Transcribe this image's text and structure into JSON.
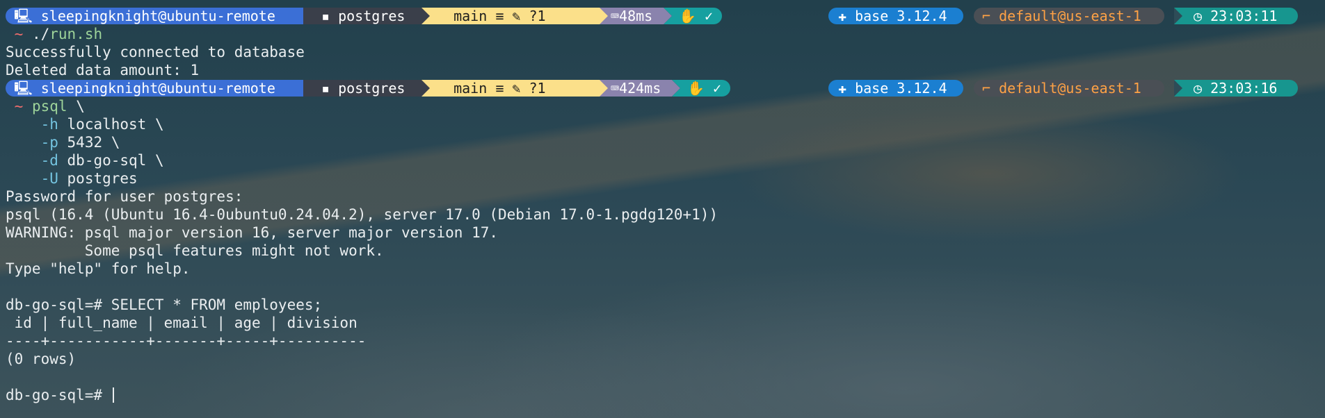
{
  "prompts": [
    {
      "os_icon": "🖳",
      "user_host": "sleepingknight@ubuntu-remote",
      "folder_icon": "▪",
      "path": "postgres",
      "github_icon": "",
      "branch_icon": "",
      "branch": "main",
      "git_status": "≡ ✎ ?1",
      "exec_icon": "⌨",
      "exec_time": "48ms",
      "status_icon": "✋",
      "status_check": "✓",
      "python_icon": "✚",
      "python": "base 3.12.4",
      "aws_icon": "⌐",
      "aws": "default@us-east-1",
      "clock_icon": "◷",
      "time": "23:03:11"
    },
    {
      "os_icon": "🖳",
      "user_host": "sleepingknight@ubuntu-remote",
      "folder_icon": "▪",
      "path": "postgres",
      "github_icon": "",
      "branch_icon": "",
      "branch": "main",
      "git_status": "≡ ✎ ?1",
      "exec_icon": "⌨",
      "exec_time": "424ms",
      "status_icon": "✋",
      "status_check": "✓",
      "python_icon": "✚",
      "python": "base 3.12.4",
      "aws_icon": "⌐",
      "aws": "default@us-east-1",
      "clock_icon": "◷",
      "time": "23:03:16"
    }
  ],
  "cmd1": {
    "tilde": "~",
    "prefix": "./",
    "script": "run.sh"
  },
  "output1": [
    "Successfully connected to database",
    "Deleted data amount: 1"
  ],
  "cmd2": {
    "tilde": "~",
    "command": "psql",
    "cont": "\\",
    "args": [
      {
        "flag": "-h",
        "value": "localhost \\"
      },
      {
        "flag": "-p",
        "value": "5432 \\"
      },
      {
        "flag": "-d",
        "value": "db-go-sql \\"
      },
      {
        "flag": "-U",
        "value": "postgres"
      }
    ]
  },
  "output2": [
    "Password for user postgres:",
    "psql (16.4 (Ubuntu 16.4-0ubuntu0.24.04.2), server 17.0 (Debian 17.0-1.pgdg120+1))",
    "WARNING: psql major version 16, server major version 17.",
    "         Some psql features might not work.",
    "Type \"help\" for help.",
    "",
    "db-go-sql=# SELECT * FROM employees;",
    " id | full_name | email | age | division",
    "----+-----------+-------+-----+----------",
    "(0 rows)",
    ""
  ],
  "final_prompt": "db-go-sql=# "
}
